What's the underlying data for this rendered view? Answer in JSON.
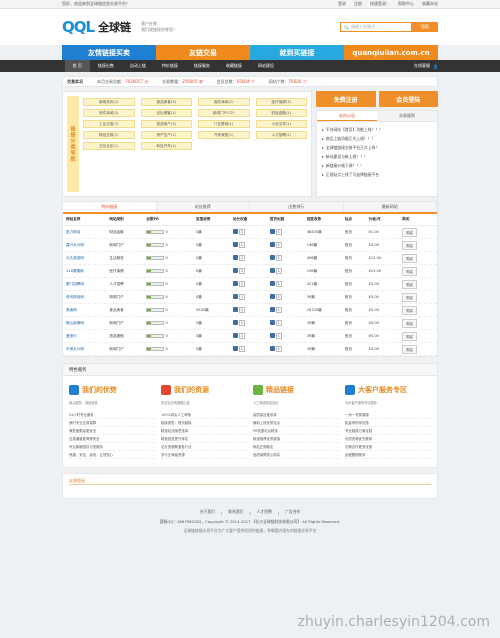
{
  "topbar": {
    "welcome": "您好，欢迎来到全球链信息交易平台！",
    "login": "登录",
    "register": "注册",
    "status": "快速登录：",
    "help": "帮助中心",
    "favorite": "收藏本站"
  },
  "header": {
    "logo_mark": "QQL",
    "logo_name": "全球链",
    "slogan_line1": "客户在哪",
    "slogan_line2": "我们就链接到哪里！",
    "search_placeholder": "请输入关键词",
    "search_button": "搜索"
  },
  "banners": [
    {
      "label": "友情链接买卖",
      "color": "#1f7fd0"
    },
    {
      "label": "友链交易",
      "color": "#f08a1e"
    },
    {
      "label": "就到买链接",
      "color": "#27a9df"
    },
    {
      "label": "quanqiulian.com.cn",
      "color": "#f08a1e"
    }
  ],
  "nav": {
    "items": [
      "首 页",
      "链接出售",
      "自动上链",
      "特价链接",
      "链接服务",
      "收藏链接",
      "网站建设"
    ],
    "online": "在线客服"
  },
  "stats": {
    "title": "交易实况",
    "items": [
      {
        "label": "本月交易总额：",
        "value": "7636057 元"
      },
      {
        "label": "交易数量：",
        "value": "256005 笔"
      },
      {
        "label": "会员总数：",
        "value": "65604 个"
      },
      {
        "label": "网站个数：",
        "value": "76620 个"
      }
    ]
  },
  "categories": {
    "side_label": "链接分类导航",
    "items": [
      "新闻资讯(2)",
      "食品美食(3)",
      "娱乐休闲(2)",
      "医疗保健(3)",
      "软件商城(3)",
      "论坛博客(1)",
      "新闻门户(72)",
      "财经金融(1)",
      "工业交易(7)",
      "旅游房产(3)",
      "IT互联网(1)",
      "小说文学(1)",
      "财经交易(1)",
      "房产生产(1)",
      "汽车家居(1)",
      "人才招聘(2)",
      "交友社区(1)",
      "科技汽车(1)"
    ]
  },
  "actions": {
    "register": "免费注册",
    "login": "会员登陆"
  },
  "notice": {
    "tabs": [
      "站内公告",
      "交易规则"
    ],
    "items": [
      "平台网站【首页】功能上线！！！",
      "商品上链功能正式上线！！！",
      "全球链链接交易平台正式上线！",
      "新站建设与新上线！！！",
      "新链接价格下调！！！",
      "正规站点上线了可选择链接平台"
    ]
  },
  "table": {
    "tabs": [
      "特价链接",
      "站长推荐",
      "出售排行",
      "最新网站"
    ],
    "headers": [
      "网站名称",
      "网站类别",
      "谷歌PR",
      "百度收录",
      "站长权重",
      "首页出链",
      "百度收录",
      "站点",
      "价格/月",
      "购买"
    ],
    "rows": [
      {
        "name": "张力财经",
        "cat": "财经金融",
        "pr": "0",
        "inc": "0篇",
        "w": "1",
        "out": "1",
        "inc2": "36200篇",
        "pos": "首页",
        "price": "¥1.00",
        "buy": "购买"
      },
      {
        "name": "嘉兴大众网",
        "cat": "新闻门户",
        "pr": "0",
        "inc": "0篇",
        "w": "1",
        "out": "1",
        "inc2": "146篇",
        "pos": "首页",
        "price": "¥3.00",
        "buy": "购买"
      },
      {
        "name": "久久旅游网",
        "cat": "生活服务",
        "pr": "0",
        "inc": "0篇",
        "w": "1",
        "out": "1",
        "inc2": "498篇",
        "pos": "首页",
        "price": "¥12.00",
        "buy": "购买"
      },
      {
        "name": "318健康网",
        "cat": "医疗保健",
        "pr": "0",
        "inc": "0篇",
        "w": "1",
        "out": "1",
        "inc2": "156篇",
        "pos": "首页",
        "price": "¥12.00",
        "buy": "购买"
      },
      {
        "name": "厦门招聘网",
        "cat": "人才招聘",
        "pr": "0",
        "inc": "0篇",
        "w": "1",
        "out": "1",
        "inc2": "421篇",
        "pos": "首页",
        "price": "¥3.00",
        "buy": "购买"
      },
      {
        "name": "资讯财经网",
        "cat": "新闻门户",
        "pr": "0",
        "inc": "0篇",
        "w": "1",
        "out": "1",
        "inc2": "39篇",
        "pos": "首页",
        "price": "¥3.00",
        "buy": "购买"
      },
      {
        "name": "美食网",
        "cat": "食品美食",
        "pr": "0",
        "inc": "5500篇",
        "w": "1",
        "out": "1",
        "inc2": "18700篇",
        "pos": "首页",
        "price": "¥3.00",
        "buy": "购买"
      },
      {
        "name": "佛山新闻网",
        "cat": "新闻门户",
        "pr": "0",
        "inc": "0篇",
        "w": "1",
        "out": "1",
        "inc2": "39篇",
        "pos": "首页",
        "price": "¥3.00",
        "buy": "购买"
      },
      {
        "name": "爱旅行",
        "cat": "旅游度假",
        "pr": "0",
        "inc": "0篇",
        "w": "1",
        "out": "1",
        "inc2": "39篇",
        "pos": "首页",
        "price": "¥3.00",
        "buy": "购买"
      },
      {
        "name": "东莞大众网",
        "cat": "新闻门户",
        "pr": "0",
        "inc": "0篇",
        "w": "1",
        "out": "1",
        "inc2": "39篇",
        "pos": "首页",
        "price": "¥3.00",
        "buy": "购买"
      }
    ]
  },
  "services": {
    "title": "特色服务",
    "cols": [
      {
        "title": "我们的优势",
        "color": "#1f7fd0",
        "desc": "用心服务，诚信经营",
        "items": [
          "24小时专业服务",
          "我们专业交易保障",
          "满意度更高更安全",
          "交易通道更简便安全",
          "专业客服团队为您服务",
          "快捷、安全、高效，让您放心"
        ]
      },
      {
        "title": "我们的资源",
        "color": "#e5482e",
        "desc": "丰富站点资源随心选",
        "items": [
          "100%真实人工审核",
          "链接类型：首页链接",
          "精选站点随意选择",
          "精准投放提升排名",
          "站长资源覆盖各行业",
          "多行业海量资源"
        ]
      },
      {
        "title": "精品链接",
        "color": "#6cb33f",
        "desc": "人工筛选精品站点",
        "items": [
          "高质量百度收录",
          "最新上线优质站点",
          "PR权重站点精选",
          "精选推荐优质链接",
          "网站正规稳定",
          "品质保障放心购买"
        ]
      },
      {
        "title": "大客户服务专区",
        "color": "#1f7fd0",
        "desc": "为大客户提供专业服务",
        "items": [
          "一对一专属客服",
          "批量采购享优惠",
          "专业链接方案定制",
          "优质资源优先推荐",
          "长期合作更多优惠",
          "全程跟踪服务"
        ]
      }
    ]
  },
  "links": {
    "title": "友情链接"
  },
  "footer": {
    "nav": [
      "关于我们",
      "联系我们",
      "人才招聘",
      "广告合作"
    ],
    "copyright": "客服QQ：3697562263，Copyright © 2014-2017 【长沙全球链科技有限公司】 All Rights Reserved.",
    "note": "全球链链接交易平台为广大客户提供优质的链接，争做国内领先的链接交易平台",
    "watermark": "zhuyin.charlesyin1204.com"
  }
}
